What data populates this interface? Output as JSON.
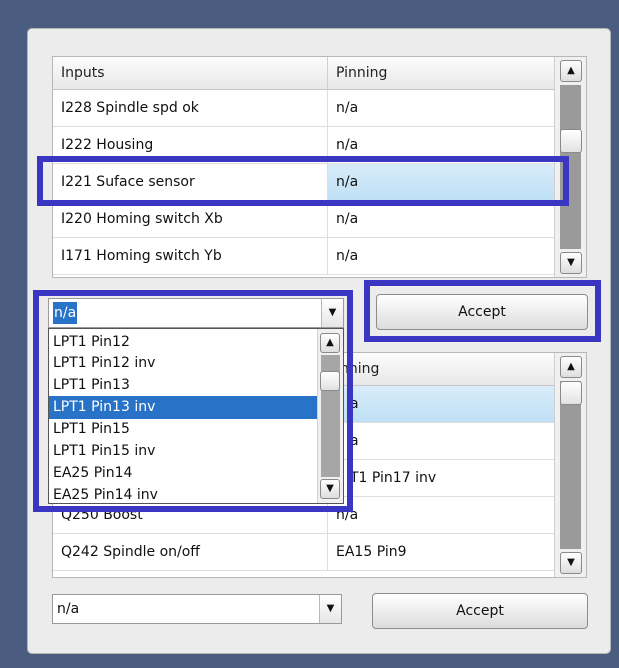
{
  "inputs_table": {
    "headers": [
      "Inputs",
      "Pinning"
    ],
    "rows": [
      [
        "I228 Spindle spd ok",
        "n/a"
      ],
      [
        "I222 Housing",
        "n/a"
      ],
      [
        "I221 Suface sensor",
        "n/a"
      ],
      [
        "I220 Homing switch Xb",
        "n/a"
      ],
      [
        "I171 Homing switch Yb",
        "n/a"
      ]
    ],
    "selected_row": 2
  },
  "top_combo": {
    "value": "n/a",
    "dropdown_arrow": "chevron-down-icon"
  },
  "top_accept_label": "Accept",
  "dropdown": {
    "items": [
      "LPT1 Pin12",
      "LPT1 Pin12 inv",
      "LPT1 Pin13",
      "LPT1 Pin13 inv",
      "LPT1 Pin15",
      "LPT1 Pin15 inv",
      "EA25 Pin14",
      "EA25 Pin14 inv"
    ],
    "selected_index": 3
  },
  "outputs_table": {
    "header_visible": "nning",
    "rows": [
      [
        "",
        "a"
      ],
      [
        "",
        "a"
      ],
      [
        "",
        "T1 Pin17 inv"
      ],
      [
        "Q250 Boost",
        "n/a"
      ],
      [
        "Q242 Spindle on/off",
        "EA15 Pin9"
      ]
    ],
    "selected_row": 0
  },
  "bottom_combo": {
    "value": "n/a"
  },
  "bottom_accept_label": "Accept",
  "colors": {
    "background": "#4a5d80",
    "highlight_box": "#3a36c2",
    "selection": "#2872c8",
    "row_selection": "#bfe0f6"
  }
}
